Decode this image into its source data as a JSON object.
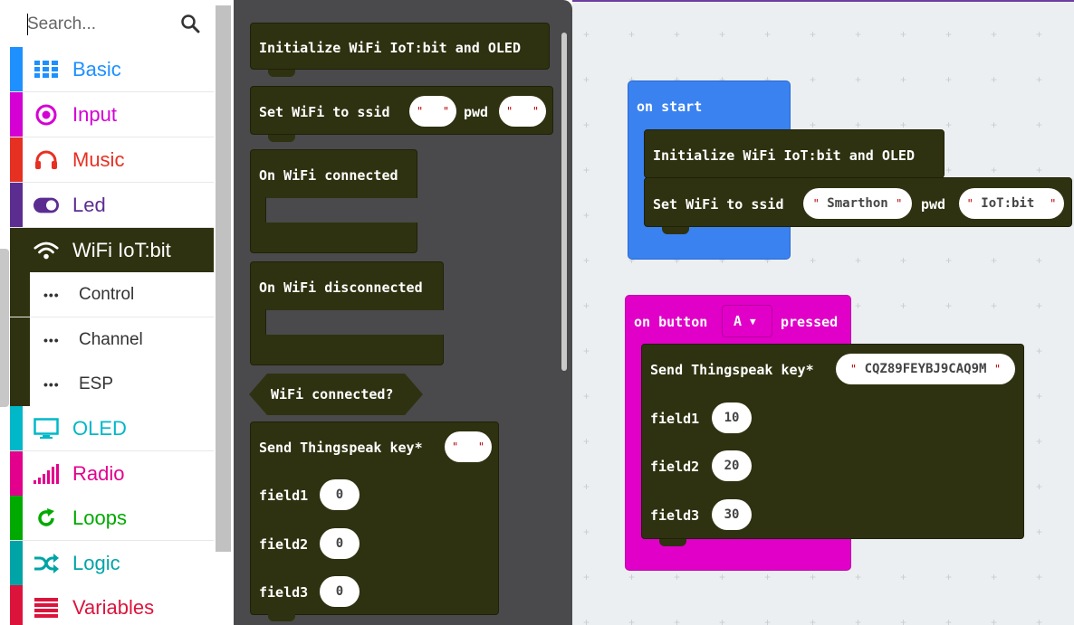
{
  "search": {
    "placeholder": "Search..."
  },
  "categories": [
    {
      "label": "Basic",
      "color": "#1e90ff",
      "icon": "grid-icon"
    },
    {
      "label": "Input",
      "color": "#d400d4",
      "icon": "target-icon"
    },
    {
      "label": "Music",
      "color": "#e63022",
      "icon": "headphones-icon"
    },
    {
      "label": "Led",
      "color": "#5c2d91",
      "icon": "toggle-icon"
    },
    {
      "label": "WiFi IoT:bit",
      "color": "#2f3210",
      "icon": "wifi-icon"
    },
    {
      "label": "OLED",
      "color": "#00b8c8",
      "icon": "monitor-icon"
    },
    {
      "label": "Radio",
      "color": "#e3008c",
      "icon": "signal-bars-icon"
    },
    {
      "label": "Loops",
      "color": "#00aa00",
      "icon": "loop-icon"
    },
    {
      "label": "Logic",
      "color": "#00a4a6",
      "icon": "shuffle-icon"
    },
    {
      "label": "Variables",
      "color": "#dc143c",
      "icon": "list-icon"
    }
  ],
  "subcategories": [
    {
      "label": "Control"
    },
    {
      "label": "Channel"
    },
    {
      "label": "ESP"
    }
  ],
  "flyout": {
    "init_block": "Initialize WiFi IoT:bit and OLED",
    "set_wifi": {
      "prefix": "Set WiFi to ssid",
      "pwd": "pwd",
      "ssid_value": "",
      "pwd_value": ""
    },
    "on_connected": "On WiFi connected",
    "on_disconnected": "On WiFi disconnected",
    "connected_check": "WiFi connected?",
    "thingspeak": {
      "label": "Send Thingspeak key*",
      "key_value": "",
      "fields": [
        {
          "name": "field1",
          "value": "0"
        },
        {
          "name": "field2",
          "value": "0"
        },
        {
          "name": "field3",
          "value": "0"
        }
      ]
    }
  },
  "workspace": {
    "on_start": {
      "label": "on start",
      "init": "Initialize WiFi IoT:bit and OLED",
      "set_wifi_prefix": "Set WiFi to ssid",
      "ssid": "Smarthon",
      "pwd_label": "pwd",
      "pwd": "IoT:bit"
    },
    "on_button": {
      "prefix": "on button",
      "button": "A",
      "suffix": "pressed",
      "thingspeak_label": "Send Thingspeak key*",
      "key": "CQZ89FEYBJ9CAQ9M",
      "fields": [
        {
          "name": "field1",
          "value": "10"
        },
        {
          "name": "field2",
          "value": "20"
        },
        {
          "name": "field3",
          "value": "30"
        }
      ]
    }
  },
  "colors": {
    "wifi_block": "#2f3210",
    "on_start": "#3a82f0",
    "on_button": "#e100c8",
    "flyout_bg": "#4a4a4c",
    "workspace_bg": "#eceff1"
  }
}
